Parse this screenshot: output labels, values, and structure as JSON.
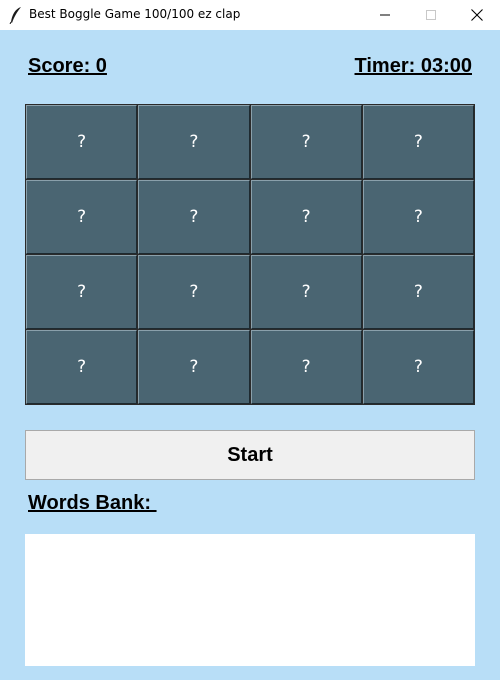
{
  "window": {
    "title": "Best Boggle Game 100/100 ez clap",
    "app_icon": "feather-icon",
    "controls": [
      "minimize-icon",
      "maximize-icon",
      "close-icon"
    ]
  },
  "header": {
    "score_text": "Score: 0",
    "timer_text": "Timer: 03:00"
  },
  "board": {
    "rows": [
      [
        "?",
        "?",
        "?",
        "?"
      ],
      [
        "?",
        "?",
        "?",
        "?"
      ],
      [
        "?",
        "?",
        "?",
        "?"
      ],
      [
        "?",
        "?",
        "?",
        "?"
      ]
    ]
  },
  "start_button": {
    "label": "Start"
  },
  "words_bank": {
    "label": "Words Bank: ",
    "words": []
  },
  "colors": {
    "background": "#b8def7",
    "tile": "#4a6572",
    "tile_text": "#ffffff",
    "button": "#f0f0f0",
    "words_bank": "#ffffff"
  }
}
